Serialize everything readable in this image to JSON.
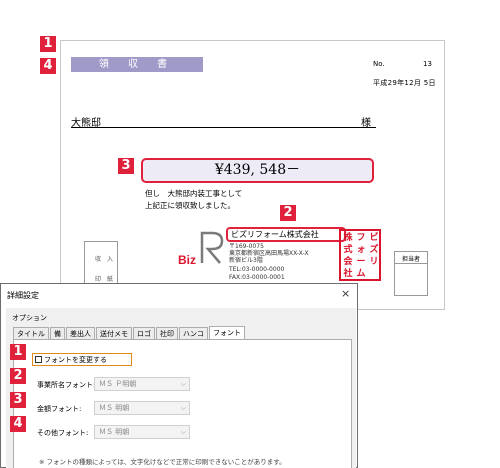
{
  "receipt": {
    "title": "領 収 書",
    "no_label": "No.",
    "no_value": "13",
    "date": "平成29年12月 5日",
    "addressee": "大熊邸",
    "honorific": "様",
    "amount": "¥439, 548－",
    "note_line1": "但し　大熊邸内装工事として",
    "note_line2": "上記正に領収致しました。",
    "revenue_stamp_line1": "収　入",
    "revenue_stamp_line2": "印　紙",
    "logo_text": "Biz",
    "company_name": "ビズリフォーム株式会社",
    "address_lines": [
      "〒169-0075",
      "東京都新宿区高田馬場XX-X-X",
      "新宿ビル3階",
      "TEL:03-0000-0000",
      "FAX:03-0000-0001"
    ],
    "seal_chars": [
      "ビ",
      "ズ",
      "リ",
      "フ",
      "ォ",
      "ー",
      "ム",
      "株",
      "式",
      "会",
      "社"
    ],
    "person_in_charge": "担当者"
  },
  "badges": {
    "b1": "1",
    "b4": "4",
    "b3": "3",
    "b2": "2"
  },
  "dialog": {
    "title": "詳細設定",
    "close": "×",
    "options_label": "オプション",
    "tabs": [
      "タイトル",
      "備",
      "差出人",
      "送付メモ",
      "ロゴ",
      "社印",
      "ハンコ",
      "フォント"
    ],
    "active_tab_index": 7,
    "change_font_label": "フォントを変更する",
    "change_font_checked": false,
    "fields": [
      {
        "badge": "2",
        "label": "事業所名フォント:",
        "value": "ＭＳ Ｐ明朝"
      },
      {
        "badge": "3",
        "label": "金額フォント:",
        "value": "ＭＳ 明朝"
      },
      {
        "badge": "4",
        "label": "その他フォント:",
        "value": "ＭＳ 明朝"
      }
    ],
    "checkbox_badge": "1",
    "note": "※ フォントの種類によっては、文字化けなどで正常に印刷できないことがあります。"
  },
  "colors": {
    "accent_red": "#e0213c",
    "title_bar": "#a09ac8",
    "amount_bg": "#ecebf6"
  }
}
